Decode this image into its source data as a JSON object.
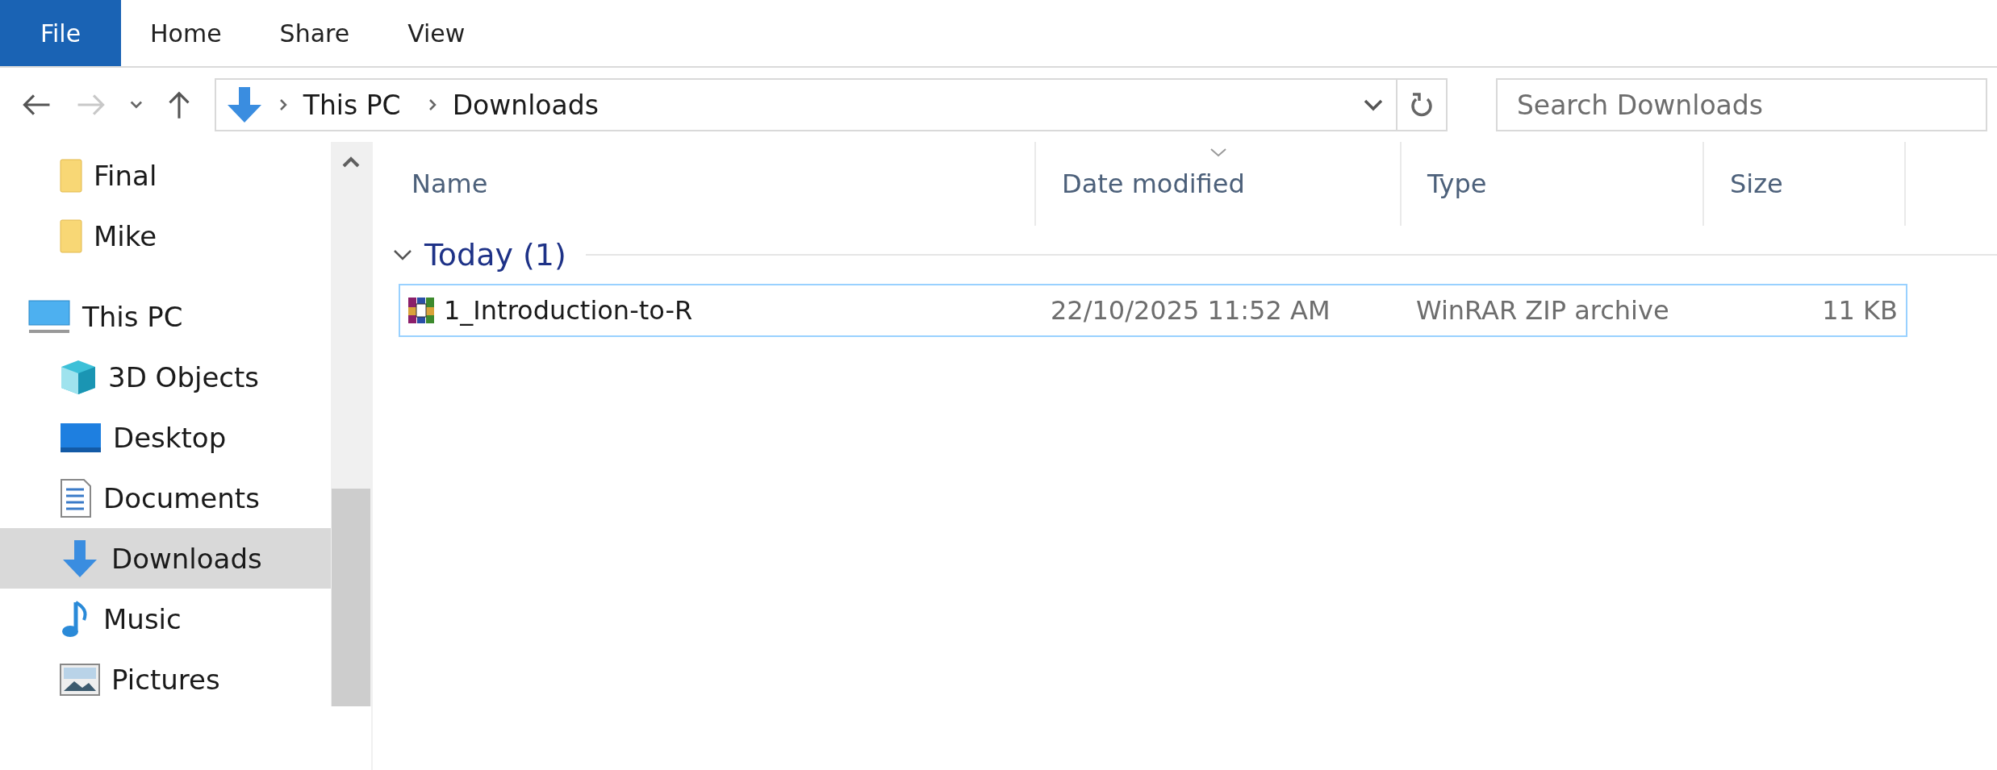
{
  "ribbon": {
    "tabs": [
      {
        "label": "File",
        "kind": "menu"
      },
      {
        "label": "Home",
        "kind": "tab"
      },
      {
        "label": "Share",
        "kind": "tab"
      },
      {
        "label": "View",
        "kind": "tab"
      }
    ]
  },
  "address_bar": {
    "segments": [
      "This PC",
      "Downloads"
    ]
  },
  "search": {
    "placeholder": "Search Downloads"
  },
  "sidebar": {
    "sections": [
      {
        "items": [
          {
            "label": "Final",
            "kind": "folder",
            "selected": false
          },
          {
            "label": "Mike",
            "kind": "folder",
            "selected": false
          }
        ]
      },
      {
        "label": "This PC",
        "kind": "pc",
        "selected": false,
        "children": [
          {
            "label": "3D Objects",
            "kind": "cube",
            "selected": false
          },
          {
            "label": "Desktop",
            "kind": "desktop",
            "selected": false
          },
          {
            "label": "Documents",
            "kind": "document",
            "selected": false
          },
          {
            "label": "Downloads",
            "kind": "download",
            "selected": true
          },
          {
            "label": "Music",
            "kind": "music",
            "selected": false
          },
          {
            "label": "Pictures",
            "kind": "pictures",
            "selected": false
          }
        ]
      }
    ]
  },
  "table": {
    "columns": [
      {
        "label": "Name",
        "sorted": false
      },
      {
        "label": "Date modified",
        "sorted": true
      },
      {
        "label": "Type",
        "sorted": false
      },
      {
        "label": "Size",
        "sorted": false
      }
    ],
    "groups": [
      {
        "label": "Today (1)",
        "expanded": true,
        "rows": [
          {
            "name": "1_Introduction-to-R",
            "date": "22/10/2025 11:52 AM",
            "type": "WinRAR ZIP archive",
            "size": "11 KB",
            "focused": true
          }
        ]
      }
    ]
  }
}
